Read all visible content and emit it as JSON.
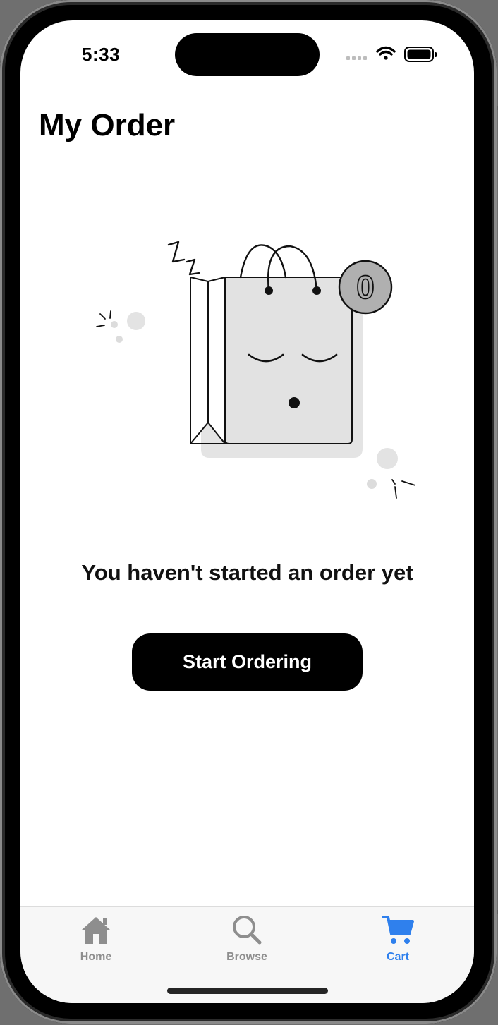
{
  "status_bar": {
    "time": "5:33"
  },
  "header": {
    "title": "My Order"
  },
  "illustration": {
    "badge_count": "0"
  },
  "empty_state": {
    "message": "You haven't started an order yet",
    "cta_label": "Start Ordering"
  },
  "tab_bar": {
    "active_color": "#2f80ed",
    "inactive_color": "#8e8e8e",
    "tabs": [
      {
        "label": "Home",
        "icon": "home-icon",
        "active": false
      },
      {
        "label": "Browse",
        "icon": "search-icon",
        "active": false
      },
      {
        "label": "Cart",
        "icon": "cart-icon",
        "active": true
      }
    ]
  }
}
